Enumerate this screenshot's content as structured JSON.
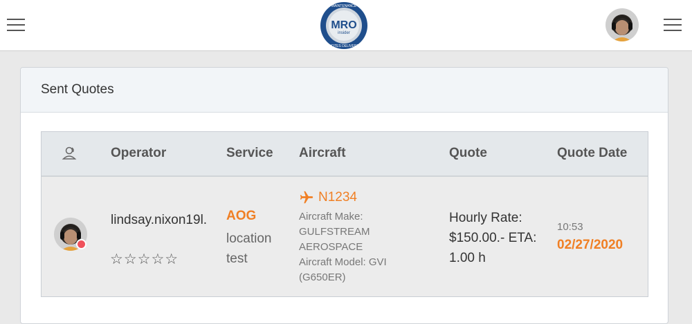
{
  "header": {
    "logo_text_main": "MRO",
    "logo_text_sub": "insider",
    "logo_text_top": "MAINTENANCE",
    "logo_text_bottom": "QUOTES DELIVERED"
  },
  "card": {
    "title": "Sent Quotes"
  },
  "table": {
    "columns": {
      "operator": "Operator",
      "service": "Service",
      "aircraft": "Aircraft",
      "quote": "Quote",
      "quote_date": "Quote Date"
    },
    "rows": [
      {
        "operator": "lindsay.nixon19l.",
        "rating_stars": 0,
        "stars_display": "☆☆☆☆☆",
        "service_type": "AOG",
        "service_desc": "location test",
        "aircraft_reg": "N1234",
        "aircraft_make": "Aircraft Make: GULFSTREAM AEROSPACE",
        "aircraft_model": "Aircraft Model: GVI (G650ER)",
        "quote_text": "Hourly Rate: $150.00.- ETA: 1.00 h",
        "quote_time": "10:53",
        "quote_date": "02/27/2020"
      }
    ]
  },
  "colors": {
    "accent": "#f07f24",
    "status_offline": "#f0525c",
    "logo_blue": "#1f4e8c"
  },
  "icons": {
    "menu_left": "hamburger-icon",
    "menu_right": "hamburger-icon",
    "operator_column": "user-icon",
    "aircraft": "airplane-icon"
  }
}
